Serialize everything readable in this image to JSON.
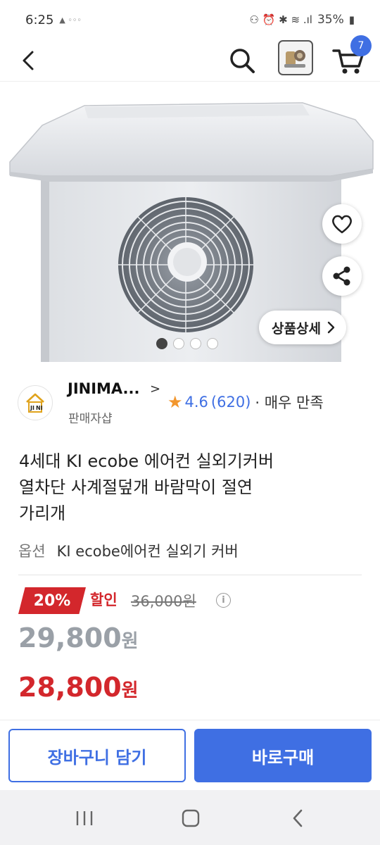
{
  "status": {
    "time": "6:25",
    "battery": "35%"
  },
  "header": {
    "cart_count": "7"
  },
  "image": {
    "detail_label": "상품상세"
  },
  "seller": {
    "name": "JINIMA...",
    "sub": "판매자샵",
    "rating": "4.6",
    "review_count": "(620)",
    "rating_text": "· 매우 만족"
  },
  "product": {
    "title_line1": "4세대 KI ecobe 에어컨 실외기커버",
    "title_line2": "열차단 사계절덮개 바람막이 절연",
    "title_line3": "가리개",
    "option_label": "옵션",
    "option_value": "KI ecobe에어컨 실외기 커버"
  },
  "price": {
    "discount_rate": "20%",
    "discount_label": "할인",
    "original": "36,000원",
    "price_1_number": "29,800",
    "price_1_unit": "원",
    "price_2_number": "28,800",
    "price_2_unit": "원"
  },
  "actions": {
    "add_to_cart": "장바구니 담기",
    "buy_now": "바로구매"
  },
  "colors": {
    "accent": "#3f6fe3",
    "sale": "#d3272c",
    "star": "#f2962d"
  }
}
